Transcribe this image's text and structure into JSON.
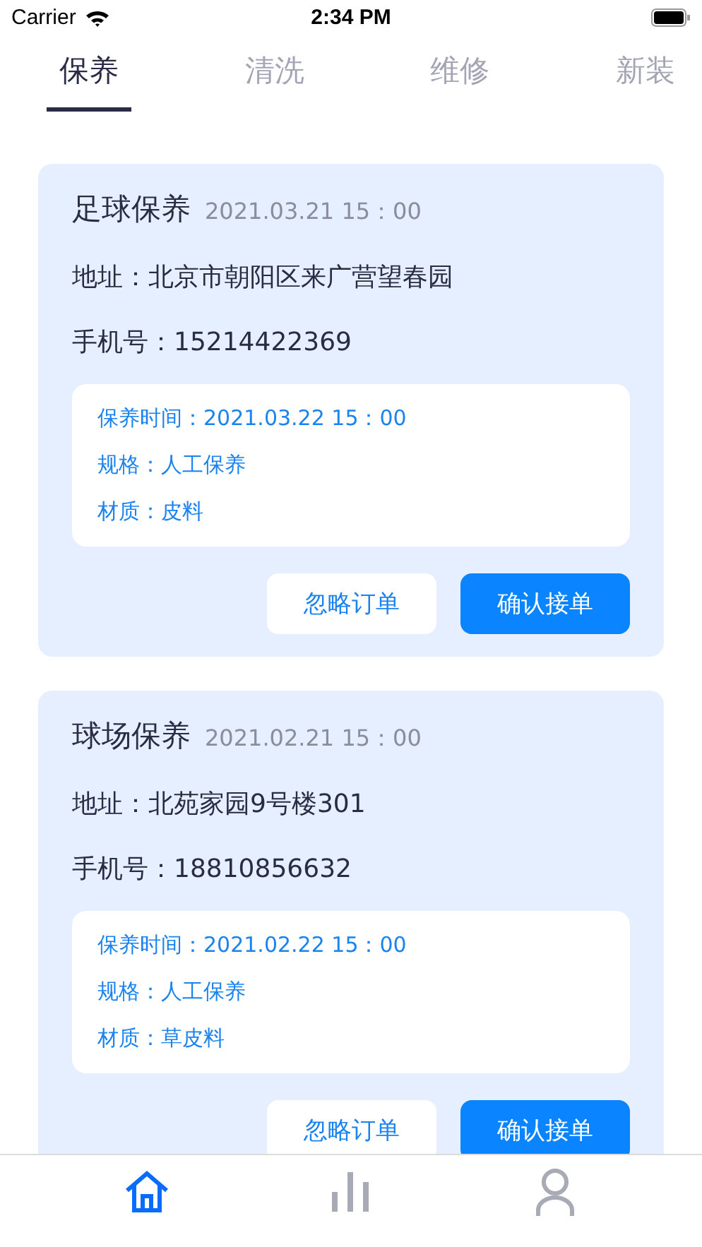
{
  "status_bar": {
    "carrier": "Carrier",
    "time": "2:34 PM"
  },
  "tabs": [
    {
      "label": "保养",
      "selected": true
    },
    {
      "label": "清洗",
      "selected": false
    },
    {
      "label": "维修",
      "selected": false
    },
    {
      "label": "新装",
      "selected": false
    }
  ],
  "orders": [
    {
      "title": "足球保养",
      "date": "2021.03.21 15：00",
      "address": "地址：北京市朝阳区来广营望春园",
      "phone": "手机号：15214422369",
      "details": [
        "保养时间：2021.03.22 15：00",
        "规格：人工保养",
        "材质：皮料"
      ],
      "buttons": [
        {
          "label": "忽略订单",
          "kind": "secondary"
        },
        {
          "label": "确认接单",
          "kind": "primary"
        }
      ]
    },
    {
      "title": "球场保养",
      "date": "2021.02.21 15：00",
      "address": "地址：北苑家园9号楼301",
      "phone": "手机号：18810856632",
      "details": [
        "保养时间：2021.02.22 15：00",
        "规格：人工保养",
        "材质：草皮料"
      ],
      "buttons": [
        {
          "label": "忽略订单",
          "kind": "secondary"
        },
        {
          "label": "确认接单",
          "kind": "primary"
        }
      ]
    }
  ],
  "bottom_nav": [
    {
      "kind": "home",
      "selected": true
    },
    {
      "kind": "stats",
      "selected": false
    },
    {
      "kind": "profile",
      "selected": false
    }
  ]
}
